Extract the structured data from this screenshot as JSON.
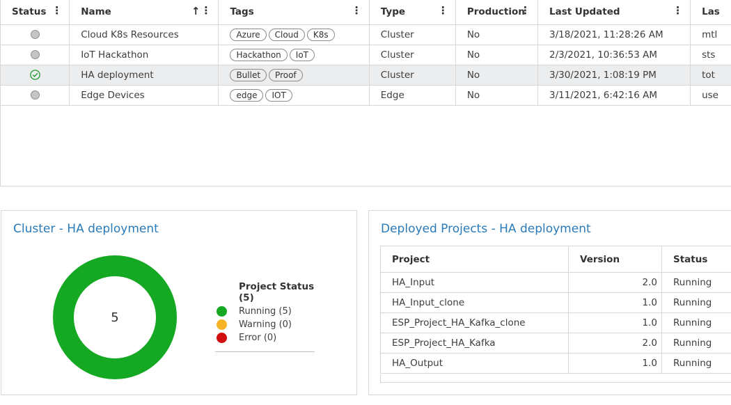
{
  "grid": {
    "columns": [
      {
        "label": "Status",
        "sorted": false
      },
      {
        "label": "Name",
        "sorted": true,
        "sort_icon": "sort-ascending-icon"
      },
      {
        "label": "Tags",
        "sorted": false
      },
      {
        "label": "Type",
        "sorted": false
      },
      {
        "label": "Production",
        "sorted": false
      },
      {
        "label": "Last Updated",
        "sorted": false
      },
      {
        "label": "Las",
        "sorted": false
      }
    ],
    "rows": [
      {
        "status": "inactive",
        "name": "Cloud K8s Resources",
        "tags": [
          "Azure",
          "Cloud",
          "K8s"
        ],
        "type": "Cluster",
        "production": "No",
        "last_updated": "3/18/2021, 11:28:26 AM",
        "last_by": "mtl"
      },
      {
        "status": "inactive",
        "name": "IoT Hackathon",
        "tags": [
          "Hackathon",
          "IoT"
        ],
        "type": "Cluster",
        "production": "No",
        "last_updated": "2/3/2021, 10:36:53 AM",
        "last_by": "sts"
      },
      {
        "status": "active",
        "name": "HA deployment",
        "tags": [
          "Bullet",
          "Proof"
        ],
        "type": "Cluster",
        "production": "No",
        "last_updated": "3/30/2021, 1:08:19 PM",
        "last_by": "tot",
        "selected": true
      },
      {
        "status": "inactive",
        "name": "Edge Devices",
        "tags": [
          "edge",
          "IOT"
        ],
        "type": "Edge",
        "production": "No",
        "last_updated": "3/11/2021, 6:42:16 AM",
        "last_by": "use"
      }
    ]
  },
  "cluster_panel": {
    "title": "Cluster - HA deployment",
    "donut_total": "5",
    "legend_title": "Project Status (5)",
    "legend": [
      {
        "label": "Running (5)",
        "color": "#15a822",
        "value": 5
      },
      {
        "label": "Warning (0)",
        "color": "#f5b325",
        "value": 0
      },
      {
        "label": "Error (0)",
        "color": "#d20f0f",
        "value": 0
      }
    ]
  },
  "projects_panel": {
    "title": "Deployed Projects - HA deployment",
    "columns": [
      "Project",
      "Version",
      "Status"
    ],
    "rows": [
      {
        "project": "HA_Input",
        "version": "2.0",
        "status": "Running"
      },
      {
        "project": "HA_Input_clone",
        "version": "1.0",
        "status": "Running"
      },
      {
        "project": "ESP_Project_HA_Kafka_clone",
        "version": "1.0",
        "status": "Running"
      },
      {
        "project": "ESP_Project_HA_Kafka",
        "version": "2.0",
        "status": "Running"
      },
      {
        "project": "HA_Output",
        "version": "1.0",
        "status": "Running"
      }
    ]
  }
}
